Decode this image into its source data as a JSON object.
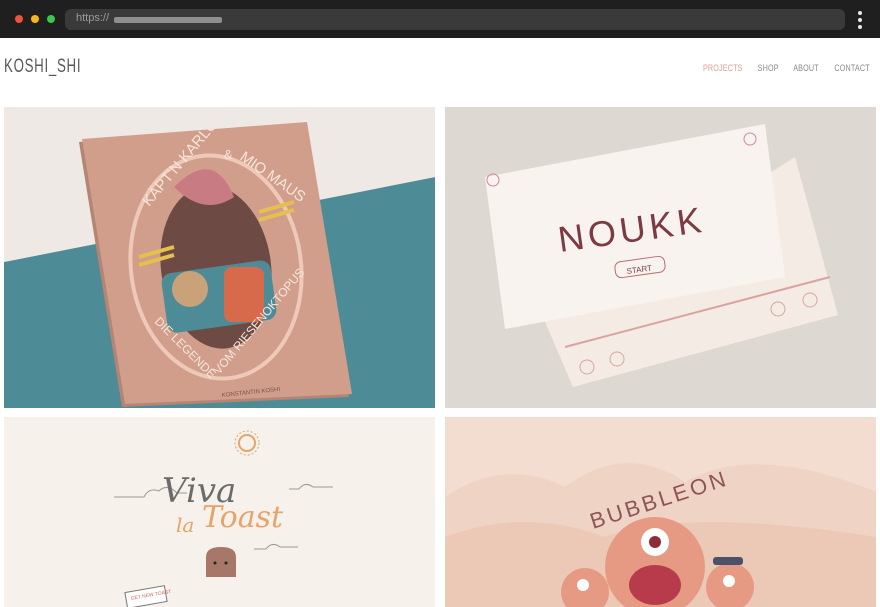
{
  "browser": {
    "url_prefix": "https://",
    "icons": [
      "close-dot",
      "minimize-dot",
      "maximize-dot",
      "kebab-menu-icon"
    ]
  },
  "site": {
    "logo": "KOSHI_SHI",
    "nav": [
      {
        "label": "PROJECTS",
        "active": true
      },
      {
        "label": "SHOP",
        "active": false
      },
      {
        "label": "ABOUT",
        "active": false
      },
      {
        "label": "CONTACT",
        "active": false
      }
    ],
    "accent_color": "#e39a95"
  },
  "projects": [
    {
      "title_line1": "KÄPT'N KARLO",
      "amp": "&",
      "title_line2": "MIO MAUS",
      "subtitle_a": "DIE LEGENDE",
      "subtitle_b": "VOM RIESENOKTOPUS",
      "author": "KONSTANTIN KOSHI"
    },
    {
      "title": "NOUKK",
      "start": "START"
    },
    {
      "title_a": "Viva",
      "title_b": "la",
      "title_c": "Toast",
      "sign": "GET NEW TOAST"
    },
    {
      "title": "BUBBLEON"
    }
  ],
  "colors": {
    "chrome": "#1f1f1f",
    "book_cover": "#d29e8c",
    "teal": "#4d8c97",
    "cream": "#f6f1ea",
    "peach": "#f3ddd0"
  }
}
